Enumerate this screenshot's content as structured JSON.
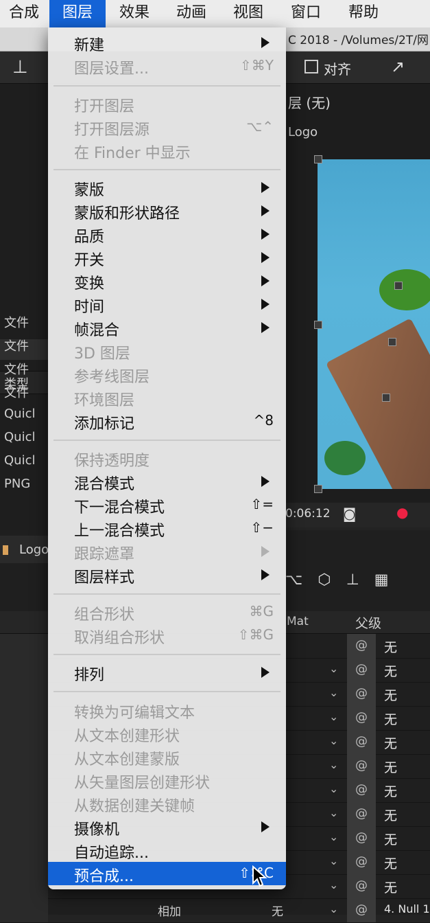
{
  "menubar": {
    "items": [
      {
        "label": "合成"
      },
      {
        "label": "图层"
      },
      {
        "label": "效果"
      },
      {
        "label": "动画"
      },
      {
        "label": "视图"
      },
      {
        "label": "窗口"
      },
      {
        "label": "帮助"
      }
    ]
  },
  "app": {
    "title_fragment": "C 2018 - /Volumes/2T/网",
    "align_label": "对齐",
    "layer_label": "层 (无)",
    "comp_tab": "Logo",
    "timecode": "0:06:12",
    "type_header": "类型",
    "type_rows": [
      "文件",
      "文件",
      "文件",
      "文件",
      "Quicl",
      "Quicl",
      "Quicl",
      "PNG"
    ],
    "timeline_tab": "Logo",
    "col_mat": "Mat",
    "col_parent": "父级",
    "parent_none": "无",
    "last_row_mode": "相加",
    "last_row_none": "无",
    "last_row_parent": "4. Null 1"
  },
  "menu": {
    "items": [
      {
        "label": "新建",
        "shortcut": "",
        "submenu": true,
        "disabled": false
      },
      {
        "label": "图层设置...",
        "shortcut": "⇧⌘Y",
        "submenu": false,
        "disabled": true
      },
      {
        "label": "打开图层",
        "shortcut": "",
        "submenu": false,
        "disabled": true
      },
      {
        "label": "打开图层源",
        "shortcut": "⌥⌃",
        "submenu": false,
        "disabled": true
      },
      {
        "label": "在 Finder 中显示",
        "shortcut": "",
        "submenu": false,
        "disabled": true
      },
      {
        "label": "蒙版",
        "shortcut": "",
        "submenu": true,
        "disabled": false
      },
      {
        "label": "蒙版和形状路径",
        "shortcut": "",
        "submenu": true,
        "disabled": false
      },
      {
        "label": "品质",
        "shortcut": "",
        "submenu": true,
        "disabled": false
      },
      {
        "label": "开关",
        "shortcut": "",
        "submenu": true,
        "disabled": false
      },
      {
        "label": "变换",
        "shortcut": "",
        "submenu": true,
        "disabled": false
      },
      {
        "label": "时间",
        "shortcut": "",
        "submenu": true,
        "disabled": false
      },
      {
        "label": "帧混合",
        "shortcut": "",
        "submenu": true,
        "disabled": false
      },
      {
        "label": "3D 图层",
        "shortcut": "",
        "submenu": false,
        "disabled": true
      },
      {
        "label": "参考线图层",
        "shortcut": "",
        "submenu": false,
        "disabled": true
      },
      {
        "label": "环境图层",
        "shortcut": "",
        "submenu": false,
        "disabled": true
      },
      {
        "label": "添加标记",
        "shortcut": "^8",
        "submenu": false,
        "disabled": false
      },
      {
        "label": "保持透明度",
        "shortcut": "",
        "submenu": false,
        "disabled": true
      },
      {
        "label": "混合模式",
        "shortcut": "",
        "submenu": true,
        "disabled": false
      },
      {
        "label": "下一混合模式",
        "shortcut": "⇧=",
        "submenu": false,
        "disabled": false
      },
      {
        "label": "上一混合模式",
        "shortcut": "⇧−",
        "submenu": false,
        "disabled": false
      },
      {
        "label": "跟踪遮罩",
        "shortcut": "",
        "submenu": true,
        "disabled": true
      },
      {
        "label": "图层样式",
        "shortcut": "",
        "submenu": true,
        "disabled": false
      },
      {
        "label": "组合形状",
        "shortcut": "⌘G",
        "submenu": false,
        "disabled": true
      },
      {
        "label": "取消组合形状",
        "shortcut": "⇧⌘G",
        "submenu": false,
        "disabled": true
      },
      {
        "label": "排列",
        "shortcut": "",
        "submenu": true,
        "disabled": false
      },
      {
        "label": "转换为可编辑文本",
        "shortcut": "",
        "submenu": false,
        "disabled": true
      },
      {
        "label": "从文本创建形状",
        "shortcut": "",
        "submenu": false,
        "disabled": true
      },
      {
        "label": "从文本创建蒙版",
        "shortcut": "",
        "submenu": false,
        "disabled": true
      },
      {
        "label": "从矢量图层创建形状",
        "shortcut": "",
        "submenu": false,
        "disabled": true
      },
      {
        "label": "从数据创建关键帧",
        "shortcut": "",
        "submenu": false,
        "disabled": true
      },
      {
        "label": "摄像机",
        "shortcut": "",
        "submenu": true,
        "disabled": false
      },
      {
        "label": "自动追踪...",
        "shortcut": "",
        "submenu": false,
        "disabled": false
      },
      {
        "label": "预合成...",
        "shortcut": "⇧⌘C",
        "submenu": false,
        "disabled": false,
        "highlighted": true
      }
    ]
  },
  "colors": {
    "menu_highlight": "#1463d6",
    "menu_bg": "#e8e8e8",
    "disabled_text": "#9a9a9a"
  }
}
